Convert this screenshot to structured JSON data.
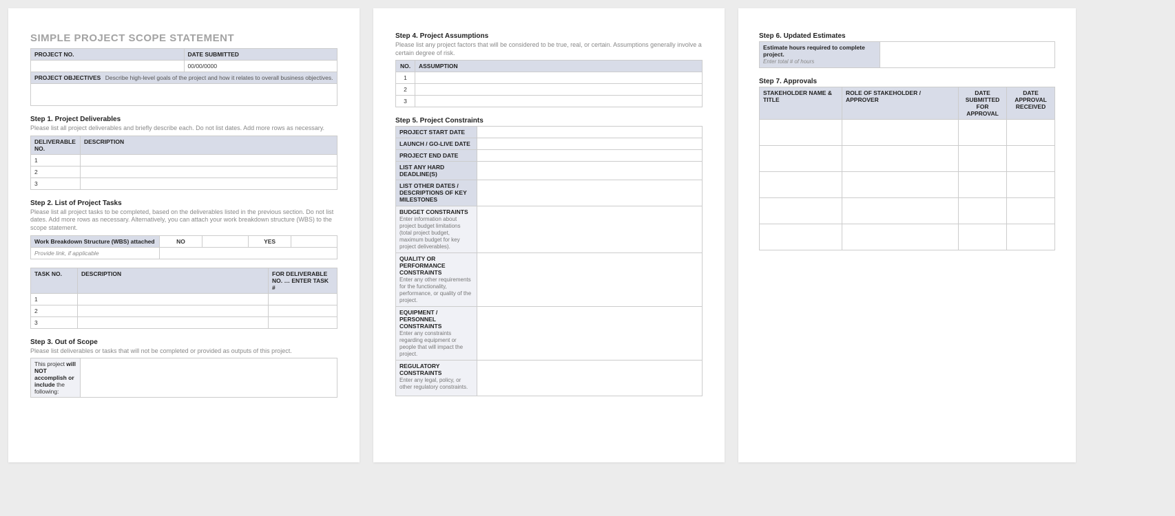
{
  "title": "SIMPLE PROJECT SCOPE STATEMENT",
  "header_table": {
    "project_no_label": "PROJECT NO.",
    "date_submitted_label": "DATE SUBMITTED",
    "project_no_value": "",
    "date_submitted_value": "00/00/0000",
    "objectives_label": "PROJECT OBJECTIVES",
    "objectives_hint": "Describe high-level goals of the project and how it relates to overall business objectives.",
    "objectives_value": ""
  },
  "step1": {
    "heading": "Step 1. Project Deliverables",
    "desc": "Please list all project deliverables and briefly describe each. Do not list dates. Add more rows as necessary.",
    "col_no": "DELIVERABLE NO.",
    "col_desc": "DESCRIPTION",
    "rows": [
      "1",
      "2",
      "3"
    ]
  },
  "step2": {
    "heading": "Step 2. List of Project Tasks",
    "desc": "Please list all project tasks to be completed, based on the deliverables listed in the previous section. Do not list dates. Add more rows as necessary. Alternatively, you can attach your work breakdown structure (WBS) to the scope statement.",
    "wbs_label": "Work Breakdown Structure (WBS) attached",
    "no_label": "NO",
    "yes_label": "YES",
    "link_label": "Provide link, if applicable",
    "task_col_no": "TASK NO.",
    "task_col_desc": "DESCRIPTION",
    "task_col_for": "FOR DELIVERABLE NO. … ENTER TASK #",
    "task_rows": [
      "1",
      "2",
      "3"
    ]
  },
  "step3": {
    "heading": "Step 3. Out of Scope",
    "desc": "Please list deliverables or tasks that will not be completed or provided as outputs of this project.",
    "side_pre": "This project ",
    "side_bold": "will NOT accomplish or include",
    "side_post": " the following:"
  },
  "step4": {
    "heading": "Step 4. Project Assumptions",
    "desc": "Please list any project factors that will be considered to be true, real, or certain. Assumptions generally involve a certain degree of risk.",
    "col_no": "NO.",
    "col_assump": "ASSUMPTION",
    "rows": [
      "1",
      "2",
      "3"
    ]
  },
  "step5": {
    "heading": "Step 5. Project Constraints",
    "labels": {
      "start": "PROJECT START DATE",
      "launch": "LAUNCH / GO-LIVE DATE",
      "end": "PROJECT END DATE",
      "deadlines": "LIST ANY HARD DEADLINE(S)",
      "milestones": "LIST OTHER DATES / DESCRIPTIONS OF KEY MILESTONES",
      "budget_t": "BUDGET CONSTRAINTS",
      "budget_d": "Enter information about project budget limitations (total project budget, maximum budget for key project deliverables).",
      "quality_t": "QUALITY OR PERFORMANCE CONSTRAINTS",
      "quality_d": "Enter any other requirements for the functionality, performance, or quality of the project.",
      "equip_t": "EQUIPMENT / PERSONNEL CONSTRAINTS",
      "equip_d": "Enter any constraints regarding equipment or people that will impact the project.",
      "reg_t": "REGULATORY CONSTRAINTS",
      "reg_d": "Enter any legal, policy, or other regulatory constraints."
    }
  },
  "step6": {
    "heading": "Step 6. Updated Estimates",
    "label": "Estimate hours required to complete project.",
    "hint": "Enter total # of hours"
  },
  "step7": {
    "heading": "Step 7. Approvals",
    "col_name": "STAKEHOLDER NAME & TITLE",
    "col_role": "ROLE OF STAKEHOLDER / APPROVER",
    "col_sub": "DATE SUBMITTED FOR APPROVAL",
    "col_rec": "DATE APPROVAL RECEIVED"
  }
}
